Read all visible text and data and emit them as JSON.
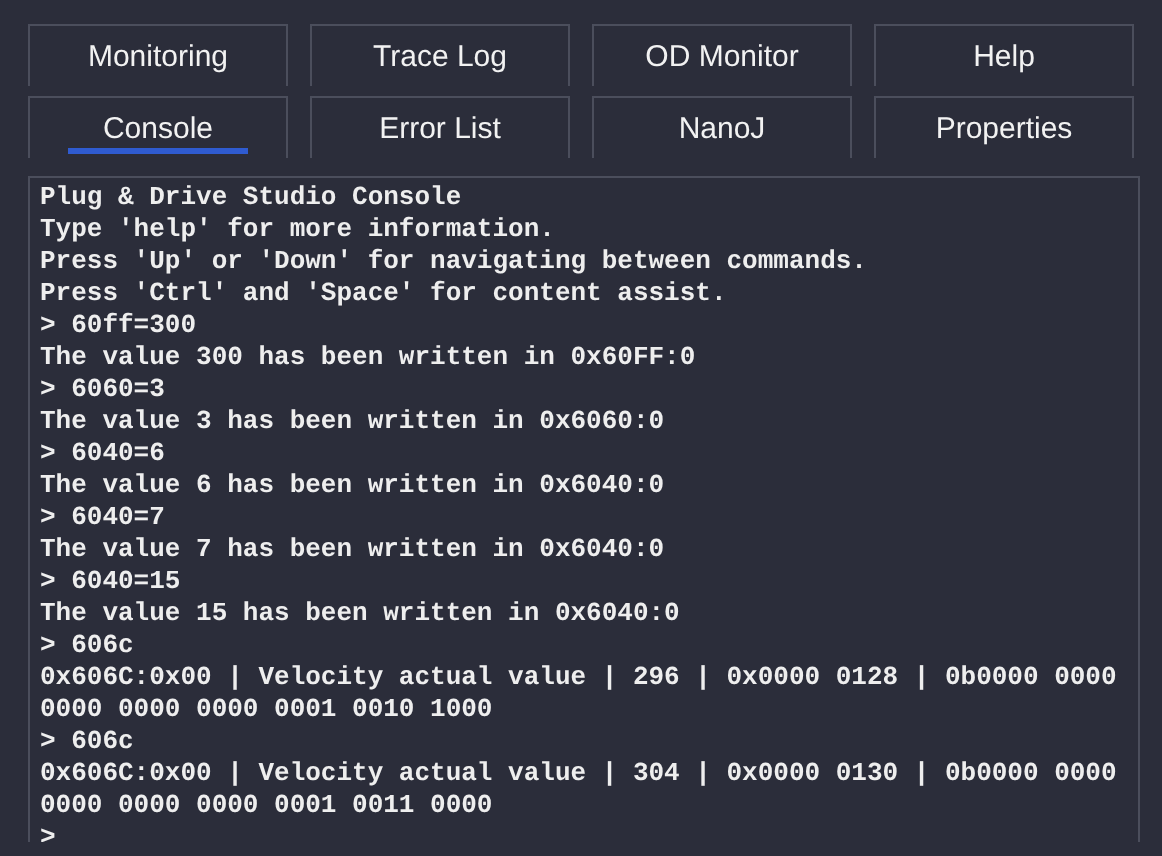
{
  "tabs": [
    {
      "label": "Monitoring",
      "selected": false
    },
    {
      "label": "Trace Log",
      "selected": false
    },
    {
      "label": "OD Monitor",
      "selected": false
    },
    {
      "label": "Help",
      "selected": false
    },
    {
      "label": "Console",
      "selected": true
    },
    {
      "label": "Error List",
      "selected": false
    },
    {
      "label": "NanoJ",
      "selected": false
    },
    {
      "label": "Properties",
      "selected": false
    }
  ],
  "console": {
    "lines": [
      "Plug & Drive Studio Console",
      "Type 'help' for more information.",
      "Press 'Up' or 'Down' for navigating between commands.",
      "Press 'Ctrl' and 'Space' for content assist.",
      "> 60ff=300",
      "The value 300 has been written in 0x60FF:0",
      "> 6060=3",
      "The value 3 has been written in 0x6060:0",
      "> 6040=6",
      "The value 6 has been written in 0x6040:0",
      "> 6040=7",
      "The value 7 has been written in 0x6040:0",
      "> 6040=15",
      "The value 15 has been written in 0x6040:0",
      "> 606c",
      "0x606C:0x00 | Velocity actual value | 296 | 0x0000 0128 | 0b0000 0000",
      "0000 0000 0000 0001 0010 1000",
      "> 606c",
      "0x606C:0x00 | Velocity actual value | 304 | 0x0000 0130 | 0b0000 0000",
      "0000 0000 0000 0001 0011 0000",
      ">"
    ]
  }
}
